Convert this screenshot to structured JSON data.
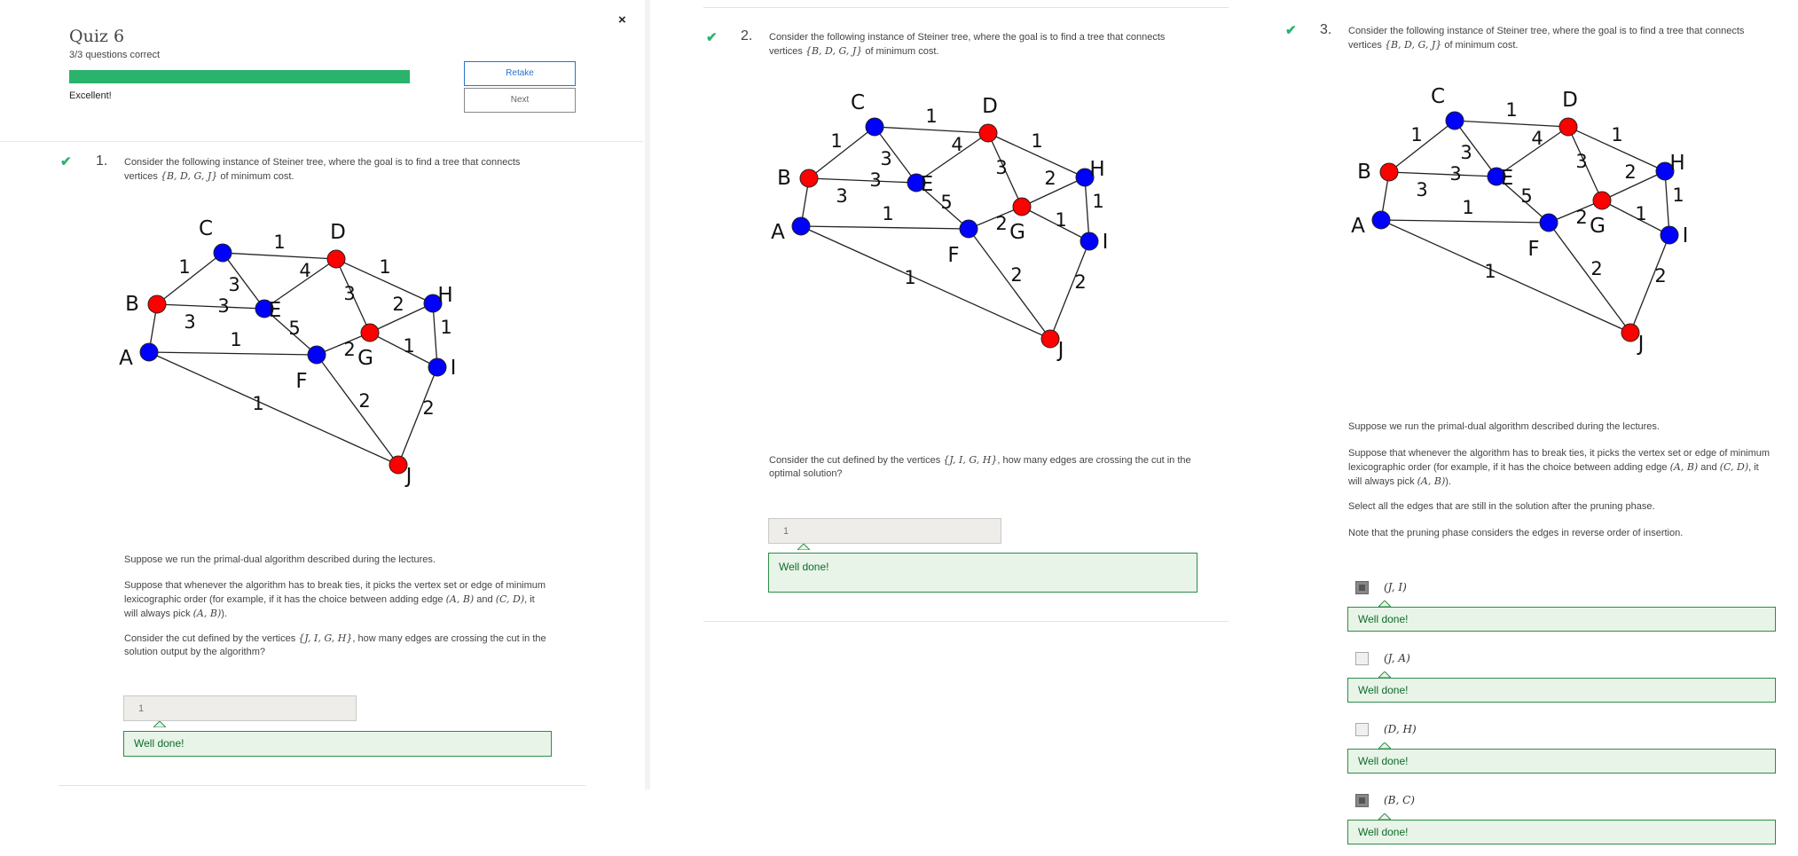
{
  "quiz": {
    "title": "Quiz 6",
    "score_text": "3/3 questions correct",
    "progress_fraction": 1.0,
    "status": "Excellent!",
    "retake_label": "Retake",
    "next_label": "Next",
    "close_glyph": "×"
  },
  "colors": {
    "accent_green": "#29b36d",
    "terminal_red": "#ff0000",
    "vertex_blue": "#0000ff",
    "link_blue": "#2a73cc"
  },
  "graph": {
    "vertices": [
      {
        "id": "C",
        "terminal": false
      },
      {
        "id": "D",
        "terminal": true
      },
      {
        "id": "B",
        "terminal": true
      },
      {
        "id": "E",
        "terminal": false
      },
      {
        "id": "G",
        "terminal": true
      },
      {
        "id": "H",
        "terminal": false
      },
      {
        "id": "A",
        "terminal": false
      },
      {
        "id": "F",
        "terminal": false
      },
      {
        "id": "I",
        "terminal": false
      },
      {
        "id": "J",
        "terminal": true
      }
    ],
    "edges": [
      {
        "u": "C",
        "v": "D",
        "w": "1"
      },
      {
        "u": "C",
        "v": "B",
        "w": "1"
      },
      {
        "u": "C",
        "v": "E",
        "w": "3"
      },
      {
        "u": "B",
        "v": "E",
        "w": "3"
      },
      {
        "u": "B",
        "v": "A",
        "w": "3"
      },
      {
        "u": "D",
        "v": "E",
        "w": "4"
      },
      {
        "u": "D",
        "v": "G",
        "w": "3"
      },
      {
        "u": "D",
        "v": "H",
        "w": "1"
      },
      {
        "u": "E",
        "v": "F",
        "w": "5"
      },
      {
        "u": "G",
        "v": "H",
        "w": "2"
      },
      {
        "u": "G",
        "v": "I",
        "w": "1"
      },
      {
        "u": "G",
        "v": "F",
        "w": "2"
      },
      {
        "u": "H",
        "v": "I",
        "w": "1"
      },
      {
        "u": "A",
        "v": "F",
        "w": "1"
      },
      {
        "u": "A",
        "v": "J",
        "w": "1"
      },
      {
        "u": "F",
        "v": "J",
        "w": "2"
      },
      {
        "u": "I",
        "v": "J",
        "w": "2"
      }
    ]
  },
  "q1": {
    "number": "1.",
    "intro_a": "Consider the following instance of Steiner tree, where the goal is to find a tree that connects",
    "intro_b_prefix": "vertices ",
    "intro_b_math": "{B, D, G, J}",
    "intro_b_suffix": " of minimum cost.",
    "para1": "Suppose we run the primal-dual algorithm described during the lectures.",
    "para2_a": "Suppose that whenever the algorithm has to break ties, it picks the vertex set or edge of minimum",
    "para2_b_prefix": "lexicographic order (for example, if it has the choice between adding edge ",
    "para2_b_m1": "(A, B)",
    "para2_b_mid": " and ",
    "para2_b_m2": "(C, D)",
    "para2_b_suffix": ", it",
    "para2_c_prefix": "will always pick ",
    "para2_c_math": "(A, B)",
    "para2_c_suffix": ").",
    "para3_a_prefix": "Consider the cut defined by the vertices ",
    "para3_a_math": "{J, I, G, H}",
    "para3_a_suffix": ", how many edges are crossing the cut in the",
    "para3_b": "solution output by the algorithm?",
    "answer": "1",
    "feedback": "Well done!"
  },
  "q2": {
    "number": "2.",
    "intro_a": "Consider the following instance of Steiner tree, where the goal is to find a tree that connects",
    "intro_b_prefix": "vertices ",
    "intro_b_math": "{B, D, G, J}",
    "intro_b_suffix": " of minimum cost.",
    "para_a_prefix": "Consider the cut defined by the vertices ",
    "para_a_math": "{J, I, G, H}",
    "para_a_suffix": ", how many edges are crossing the cut in the",
    "para_b": "optimal solution?",
    "answer": "1",
    "feedback": "Well done!"
  },
  "q3": {
    "number": "3.",
    "intro_a": "Consider the following instance of Steiner tree, where the goal is to find a tree that connects",
    "intro_b_prefix": "vertices ",
    "intro_b_math": "{B, D, G, J}",
    "intro_b_suffix": " of minimum cost.",
    "para1": "Suppose we run the primal-dual algorithm described during the lectures.",
    "para2_a": "Suppose that whenever the algorithm has to break ties, it picks the vertex set or edge of minimum",
    "para2_b_prefix": "lexicographic order (for example, if it has the choice between adding edge ",
    "para2_b_m1": "(A, B)",
    "para2_b_mid": " and ",
    "para2_b_m2": "(C, D)",
    "para2_b_suffix": ", it",
    "para2_c_prefix": "will always pick ",
    "para2_c_math": "(A, B)",
    "para2_c_suffix": ").",
    "para3": "Select all the edges that are still in the solution after the pruning phase.",
    "para4": "Note that the pruning phase considers the edges in reverse order of insertion.",
    "options": [
      {
        "label": "(J, I)",
        "checked": true,
        "feedback": "Well done!"
      },
      {
        "label": "(J, A)",
        "checked": false,
        "feedback": "Well done!"
      },
      {
        "label": "(D, H)",
        "checked": false,
        "feedback": "Well done!"
      },
      {
        "label": "(B, C)",
        "checked": true,
        "feedback": "Well done!"
      }
    ]
  }
}
